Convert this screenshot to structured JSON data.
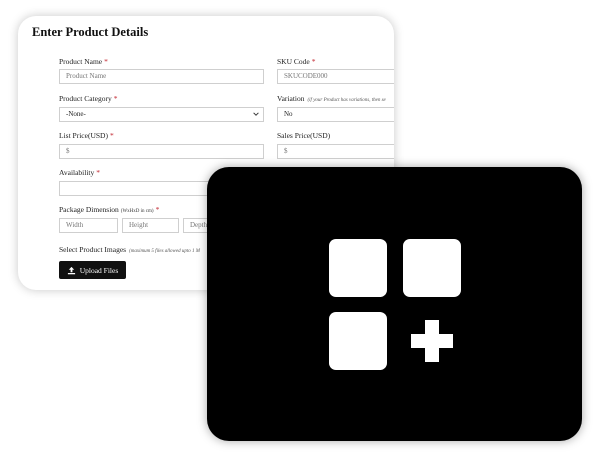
{
  "form": {
    "title": "Enter Product Details",
    "product_name": {
      "label": "Product Name",
      "placeholder": "Product Name"
    },
    "sku_code": {
      "label": "SKU Code",
      "placeholder": "SKUCODE000"
    },
    "product_category": {
      "label": "Product Category",
      "value": "-None-"
    },
    "variation": {
      "label": "Variation",
      "hint": "(if your Product has variations, then se",
      "value": "No"
    },
    "list_price": {
      "label": "List Price(USD)",
      "placeholder": "$"
    },
    "sales_price": {
      "label": "Sales Price(USD)",
      "placeholder": "$"
    },
    "availability": {
      "label": "Availability",
      "value": ""
    },
    "package_dimension": {
      "label": "Package Dimension",
      "unit": "(WxHxD in cm)",
      "width_placeholder": "Width",
      "height_placeholder": "Height",
      "depth_placeholder": "Depth"
    },
    "images": {
      "label": "Select Product Images",
      "hint": "(maximum 5 files allowed upto 1 M"
    },
    "upload_button": "Upload Files",
    "required_mark": "*"
  },
  "overlay": {
    "icon": "add-apps-icon",
    "background": "#000000",
    "foreground": "#ffffff"
  }
}
